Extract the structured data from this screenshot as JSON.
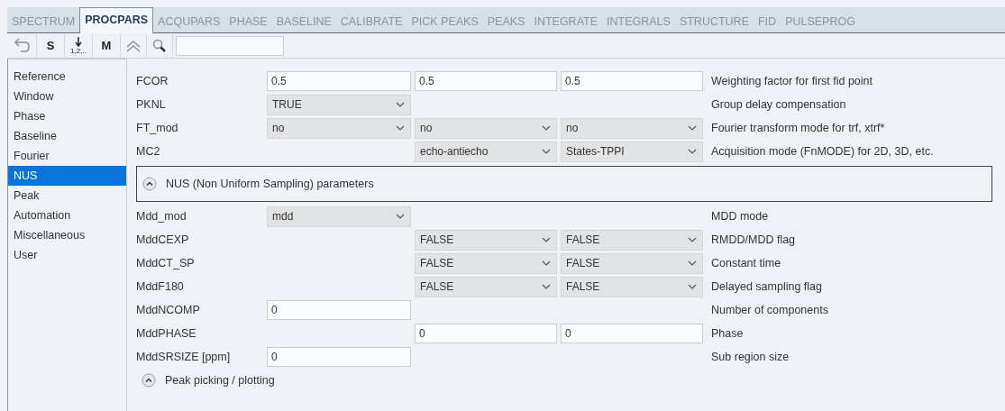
{
  "tabs": [
    {
      "label": "SPECTRUM",
      "selected": false
    },
    {
      "label": "PROCPARS",
      "selected": true
    },
    {
      "label": "ACQUPARS",
      "selected": false
    },
    {
      "label": "PHASE",
      "selected": false
    },
    {
      "label": "BASELINE",
      "selected": false
    },
    {
      "label": "CALIBRATE",
      "selected": false
    },
    {
      "label": "PICK PEAKS",
      "selected": false
    },
    {
      "label": "PEAKS",
      "selected": false
    },
    {
      "label": "INTEGRATE",
      "selected": false
    },
    {
      "label": "INTEGRALS",
      "selected": false
    },
    {
      "label": "STRUCTURE",
      "selected": false
    },
    {
      "label": "FID",
      "selected": false
    },
    {
      "label": "PULSEPROG",
      "selected": false
    }
  ],
  "toolbar": {
    "s_button": "S",
    "numbering_label": "1,2,..",
    "m_button": "M"
  },
  "sidebar": {
    "items": [
      {
        "label": "Reference",
        "selected": false
      },
      {
        "label": "Window",
        "selected": false
      },
      {
        "label": "Phase",
        "selected": false
      },
      {
        "label": "Baseline",
        "selected": false
      },
      {
        "label": "Fourier",
        "selected": false
      },
      {
        "label": "NUS",
        "selected": true
      },
      {
        "label": "Peak",
        "selected": false
      },
      {
        "label": "Automation",
        "selected": false
      },
      {
        "label": "Miscellaneous",
        "selected": false
      },
      {
        "label": "User",
        "selected": false
      }
    ]
  },
  "rows": [
    {
      "kind": "param",
      "label": "FCOR",
      "cells": [
        {
          "kind": "text",
          "value": "0.5"
        },
        {
          "kind": "text",
          "value": "0.5"
        },
        {
          "kind": "text",
          "value": "0.5"
        }
      ],
      "description": "Weighting factor for first fid point"
    },
    {
      "kind": "param",
      "label": "PKNL",
      "cells": [
        {
          "kind": "select",
          "value": "TRUE"
        },
        {
          "kind": "empty"
        },
        {
          "kind": "empty"
        }
      ],
      "description": "Group delay compensation"
    },
    {
      "kind": "param",
      "label": "FT_mod",
      "cells": [
        {
          "kind": "select",
          "value": "no"
        },
        {
          "kind": "select",
          "value": "no"
        },
        {
          "kind": "select",
          "value": "no"
        }
      ],
      "description": "Fourier transform mode for trf, xtrf*"
    },
    {
      "kind": "param",
      "label": "MC2",
      "cells": [
        {
          "kind": "empty"
        },
        {
          "kind": "select",
          "value": "echo-antiecho"
        },
        {
          "kind": "select",
          "value": "States-TPPI"
        }
      ],
      "description": "Acquisition mode (FnMODE) for 2D, 3D, etc."
    },
    {
      "kind": "section",
      "label": "NUS (Non Uniform Sampling) parameters",
      "expanded": true,
      "boxed": true
    },
    {
      "kind": "param",
      "label": "Mdd_mod",
      "cells": [
        {
          "kind": "select",
          "value": "mdd"
        },
        {
          "kind": "empty"
        },
        {
          "kind": "empty"
        }
      ],
      "description": "MDD mode"
    },
    {
      "kind": "param",
      "label": "MddCEXP",
      "cells": [
        {
          "kind": "empty"
        },
        {
          "kind": "select",
          "value": "FALSE"
        },
        {
          "kind": "select",
          "value": "FALSE"
        }
      ],
      "description": "RMDD/MDD flag"
    },
    {
      "kind": "param",
      "label": "MddCT_SP",
      "cells": [
        {
          "kind": "empty"
        },
        {
          "kind": "select",
          "value": "FALSE"
        },
        {
          "kind": "select",
          "value": "FALSE"
        }
      ],
      "description": "Constant time"
    },
    {
      "kind": "param",
      "label": "MddF180",
      "cells": [
        {
          "kind": "empty"
        },
        {
          "kind": "select",
          "value": "FALSE"
        },
        {
          "kind": "select",
          "value": "FALSE"
        }
      ],
      "description": "Delayed sampling flag"
    },
    {
      "kind": "param",
      "label": "MddNCOMP",
      "cells": [
        {
          "kind": "text",
          "value": "0"
        },
        {
          "kind": "empty"
        },
        {
          "kind": "empty"
        }
      ],
      "description": "Number of components"
    },
    {
      "kind": "param",
      "label": "MddPHASE",
      "cells": [
        {
          "kind": "empty"
        },
        {
          "kind": "text",
          "value": "0"
        },
        {
          "kind": "text",
          "value": "0"
        }
      ],
      "description": "Phase"
    },
    {
      "kind": "param",
      "label": "MddSRSIZE [ppm]",
      "cells": [
        {
          "kind": "text",
          "value": "0"
        },
        {
          "kind": "empty"
        },
        {
          "kind": "empty"
        }
      ],
      "description": "Sub region size"
    },
    {
      "kind": "section",
      "label": "Peak picking / plotting",
      "expanded": true,
      "boxed": false
    }
  ]
}
